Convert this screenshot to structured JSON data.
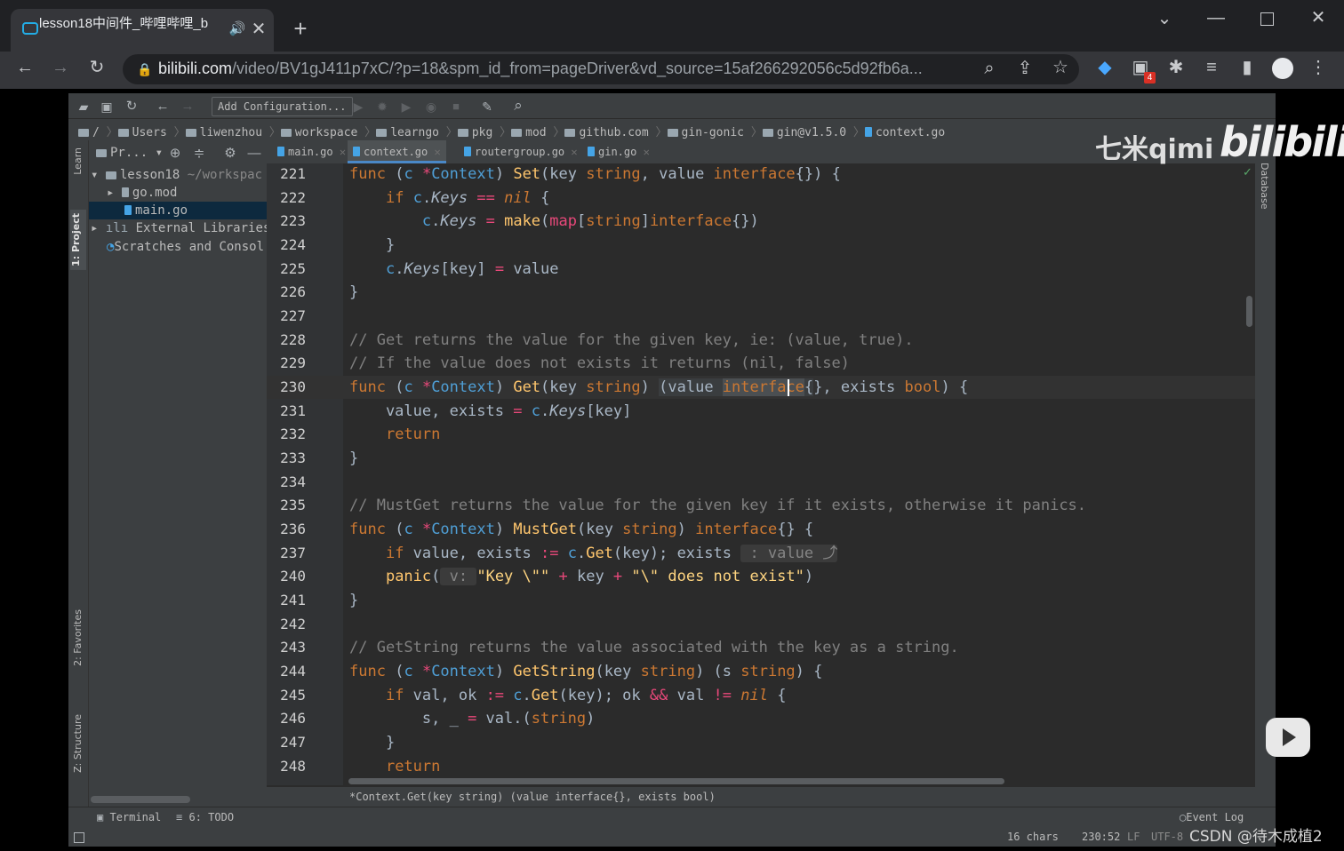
{
  "browser": {
    "tab_title": "lesson18中间件_哔哩哔哩_b",
    "url_host": "bilibili.com",
    "url_path": "/video/BV1gJ411p7xC/?p=18&spm_id_from=pageDriver&vd_source=15af266292056c5d92fb6a...",
    "extension_badge": "4"
  },
  "ide": {
    "toolbar": {
      "add_config_label": "Add Configuration..."
    },
    "breadcrumbs": [
      "/",
      "Users",
      "liwenzhou",
      "workspace",
      "learngo",
      "pkg",
      "mod",
      "github.com",
      "gin-gonic",
      "gin@v1.5.0",
      "context.go"
    ],
    "left_tools": {
      "learn": "Learn",
      "project": "1: Project",
      "favorites": "2: Favorites",
      "structure": "Z: Structure"
    },
    "right_tools": {
      "database": "Database"
    },
    "project_header": "Pr...",
    "tree": [
      {
        "label": "lesson18",
        "suffix": "~/workspac"
      },
      {
        "label": "go.mod",
        "suffix": ""
      },
      {
        "label": "main.go",
        "suffix": ""
      },
      {
        "label": "External Libraries",
        "suffix": ""
      },
      {
        "label": "Scratches and Consol",
        "suffix": ""
      }
    ],
    "file_tabs": [
      "main.go",
      "context.go",
      "routergroup.go",
      "gin.go"
    ],
    "line_numbers": [
      "221",
      "222",
      "223",
      "224",
      "225",
      "226",
      "227",
      "228",
      "229",
      "230",
      "231",
      "232",
      "233",
      "234",
      "235",
      "236",
      "237",
      "240",
      "241",
      "242",
      "243",
      "244",
      "245",
      "246",
      "247",
      "248"
    ],
    "status_hint": "*Context.Get(key string) (value interface{}, exists bool)",
    "bottom_tools": {
      "terminal": "Terminal",
      "todo": "6: TODO",
      "event_log": "Event Log"
    },
    "status": {
      "chars": "16 chars",
      "position": "230:52",
      "line_sep": "LF",
      "encoding": "UTF-8"
    }
  },
  "watermarks": {
    "qimi": "七米qimi",
    "bilibili": "bilibili",
    "csdn": "CSDN @待木成植2"
  }
}
